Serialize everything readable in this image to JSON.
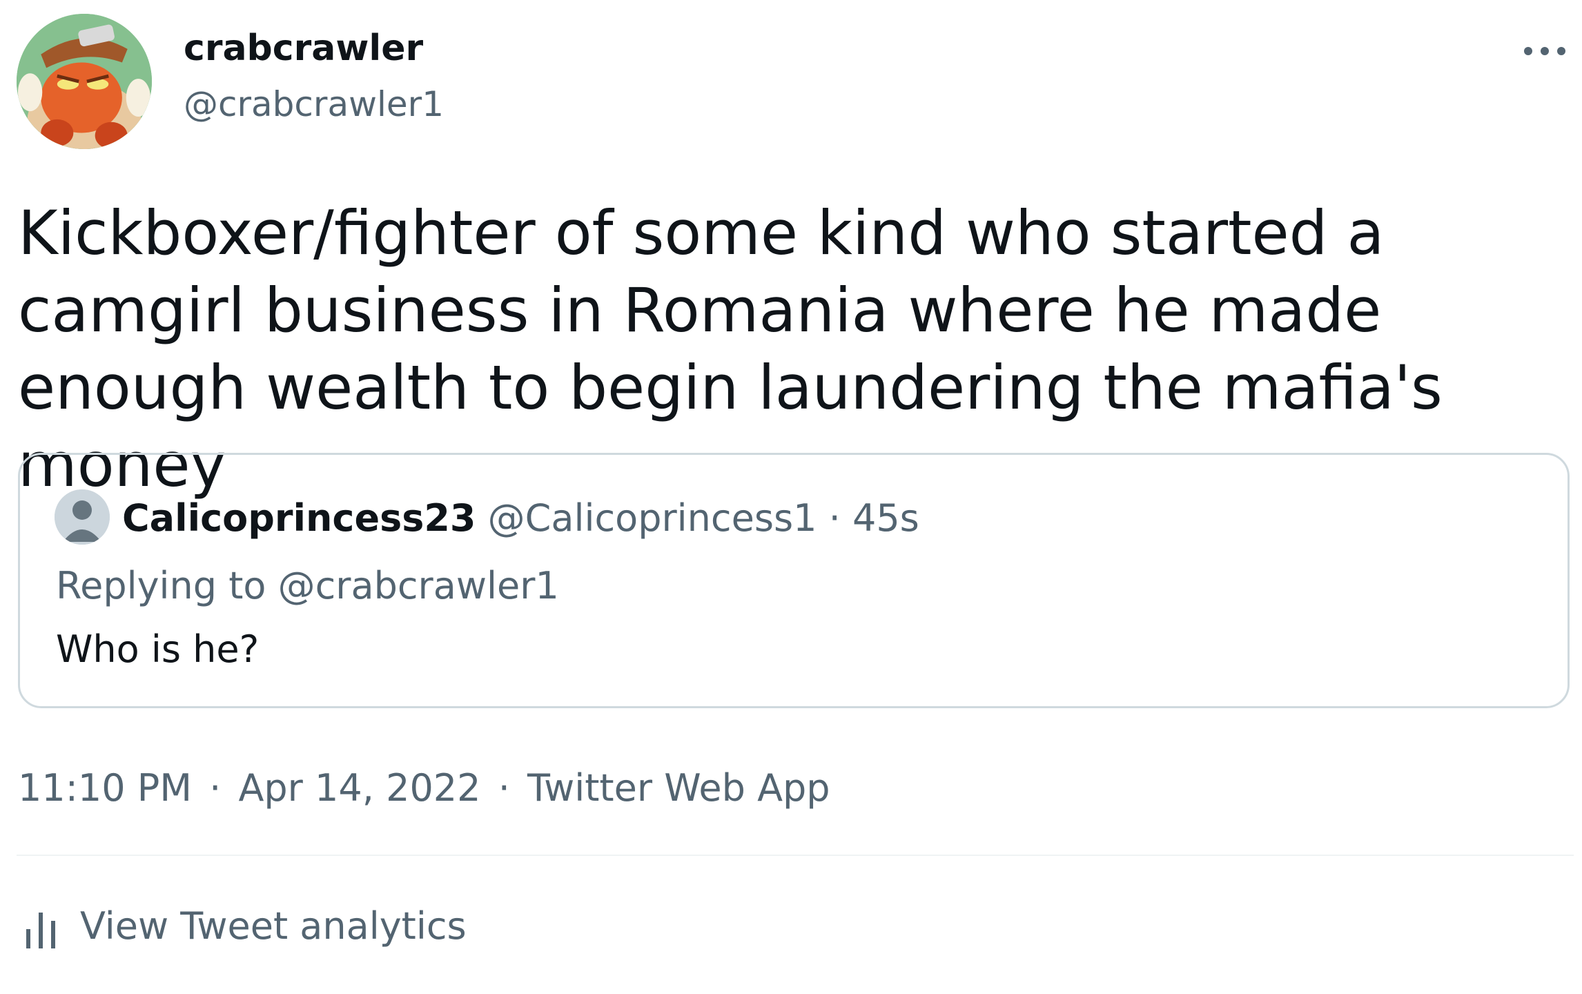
{
  "author": {
    "display_name": "crabcrawler",
    "handle": "@crabcrawler1",
    "avatar_icon": "crab-character-avatar"
  },
  "more_icon": "more-options-icon",
  "tweet_text": "Kickboxer/fighter of some kind who started a camgirl business in Romania where he made enough wealth to begin laundering the mafia's money",
  "quoted_tweet": {
    "display_name": "Calicoprincess23",
    "handle": "@Calicoprincess1",
    "separator": "·",
    "time_ago": "45s",
    "replying_prefix": "Replying to",
    "replying_to": "@crabcrawler1",
    "text": "Who is he?",
    "avatar_icon": "default-avatar-icon"
  },
  "meta": {
    "time": "11:10 PM",
    "separator": "·",
    "date": "Apr 14, 2022",
    "source": "Twitter Web App"
  },
  "analytics": {
    "label": "View Tweet analytics",
    "icon": "analytics-bar-icon"
  },
  "colors": {
    "text_primary": "#0f1419",
    "text_secondary": "#536471",
    "border": "#cfd9de"
  }
}
